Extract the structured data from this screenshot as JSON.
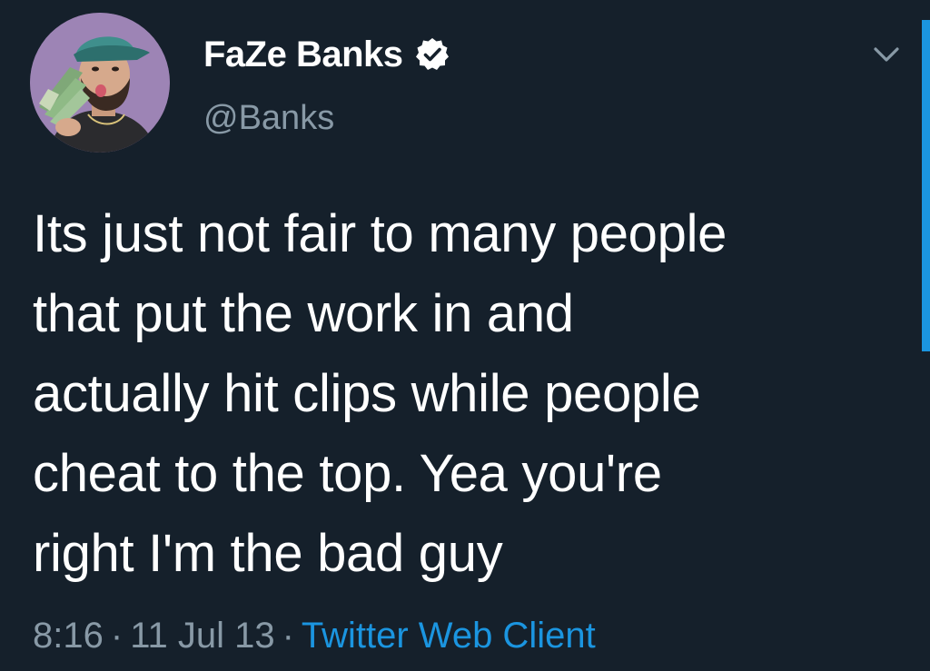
{
  "author": {
    "display_name": "FaZe Banks",
    "handle": "@Banks",
    "verified": true,
    "avatar_icon": "profile-photo"
  },
  "tweet": {
    "text": "Its just not fair to many people\nthat put the work in and\nactually hit clips while people\ncheat to the top. Yea you're\nright I'm the bad guy"
  },
  "meta": {
    "time": "8:16",
    "separator": "·",
    "date": "11 Jul 13",
    "source": "Twitter Web Client"
  },
  "icons": {
    "verified": "verified-badge-icon",
    "caret": "chevron-down-icon"
  },
  "colors": {
    "background": "#15202b",
    "accent": "#1b95e0",
    "secondary_text": "#8899a6",
    "primary_text": "#ffffff"
  }
}
